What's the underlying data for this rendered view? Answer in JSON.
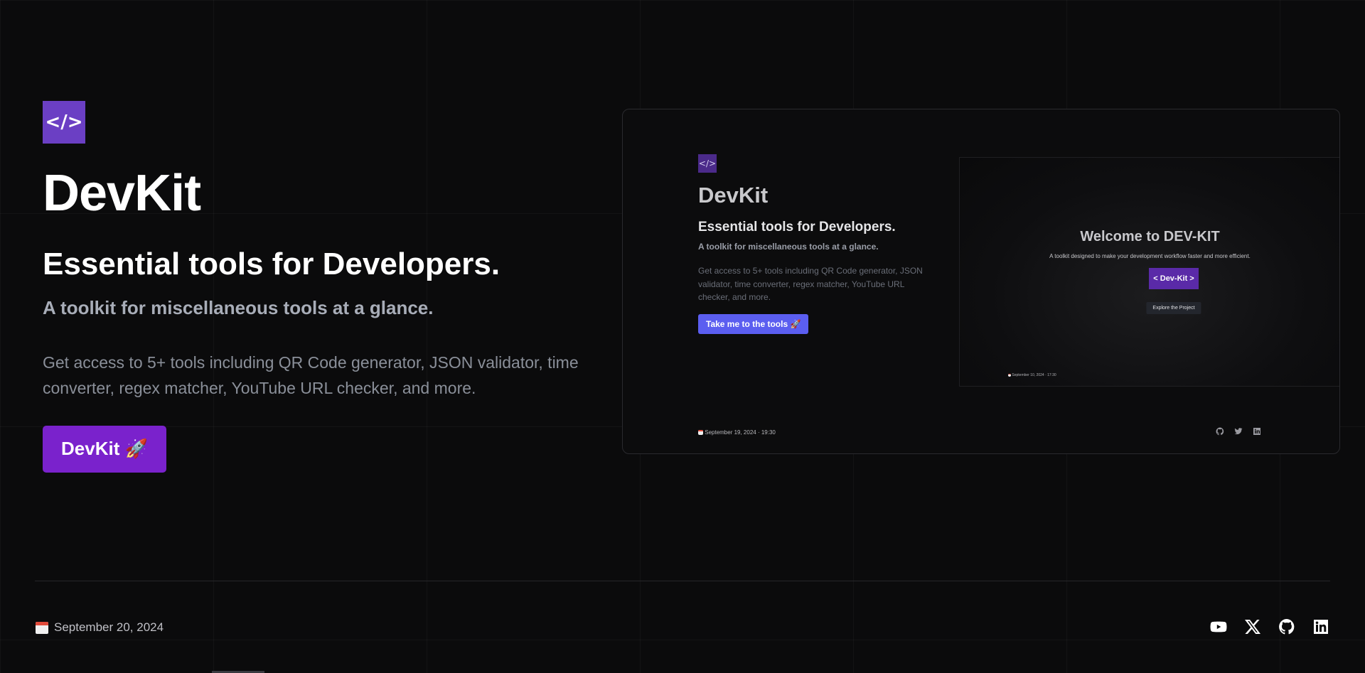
{
  "hero": {
    "logo_text": "</>",
    "title": "DevKit",
    "subtitle": "Essential tools for Developers.",
    "tagline": "A toolkit for miscellaneous tools at a glance.",
    "description": "Get access to 5+ tools including QR Code generator, JSON validator, time converter, regex matcher, YouTube URL checker, and more.",
    "cta_label": "DevKit 🚀"
  },
  "preview": {
    "logo_text": "</>",
    "title": "DevKit",
    "subtitle": "Essential tools for Developers.",
    "tagline": "A toolkit for miscellaneous tools at a glance.",
    "description": "Get access to 5+ tools including QR Code generator, JSON validator, time converter, regex matcher, YouTube URL checker, and more.",
    "button_label": "Take me to the tools 🚀",
    "footer_date": "September 19, 2024 · 19:30",
    "nested": {
      "title": "Welcome to DEV-KIT",
      "description": "A toolkit designed to make your development workflow faster and more efficient.",
      "primary_button": "< Dev-Kit >",
      "secondary_button": "Explore the Project",
      "date": "September 10, 2024 · 17:30"
    }
  },
  "footer": {
    "date": "September 20, 2024",
    "socials": [
      "youtube-icon",
      "x-icon",
      "github-icon",
      "linkedin-icon"
    ]
  },
  "colors": {
    "background": "#0b0b0c",
    "logo": "#6b3fc4",
    "cta": "#7a22cc",
    "preview_button": "#5b5ef0"
  }
}
